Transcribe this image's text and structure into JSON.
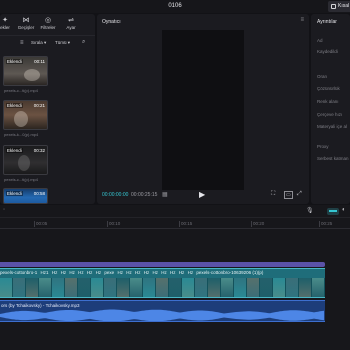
{
  "titlebar": {
    "title": "0106",
    "export_label": "Kısal"
  },
  "media": {
    "tabs": [
      {
        "label": "ekler",
        "icon": "stickers-icon"
      },
      {
        "label": "Geçişler",
        "icon": "transitions-icon"
      },
      {
        "label": "Filtreler",
        "icon": "filters-icon"
      },
      {
        "label": "Ayar",
        "icon": "adjust-icon"
      }
    ],
    "sort_label": "Sırala",
    "all_label": "Tümü",
    "items": [
      {
        "badge": "Eklendi",
        "duration": "00:11",
        "filename": "pexels-c...ti(p).mp4"
      },
      {
        "badge": "Eklendi",
        "duration": "00:21",
        "filename": "pexels-k...0(p).mp4"
      },
      {
        "badge": "Eklendi",
        "duration": "00:32",
        "filename": "pexels-c...ti(p).mp4"
      },
      {
        "badge": "Eklendi",
        "duration": "00:58",
        "filename": ""
      }
    ]
  },
  "player": {
    "title": "Oynatıcı",
    "current_time": "00:00:00:00",
    "total_time": "00:00:25:15"
  },
  "properties": {
    "title": "Ayrıntılar",
    "rows": [
      "Ad",
      "Kaydedildi",
      "Oran",
      "Çözünürlük",
      "Renk alanı",
      "Çerçeve hızı",
      "Materyali içe al",
      "Proxy",
      "Serbest katman"
    ]
  },
  "timeline": {
    "ticks": [
      "00:05",
      "00:10",
      "00:15",
      "00:20",
      "00:25"
    ],
    "clip_labels": [
      "pexels-cottonbro-1",
      "Hz1",
      "Hz",
      "Hz",
      "Hz",
      "Hz",
      "Hz",
      "Hz",
      "pexe",
      "Hz",
      "Hz",
      "Hz",
      "Hz",
      "Hz",
      "Hz",
      "Hz",
      "Hz",
      "Hz",
      "pexels-cottonbro-10639206 (1)(p)"
    ],
    "audio_label": "ors (by Tchaikovsky) - Tchaikovsky.mp3"
  },
  "colors": {
    "accent": "#35c6d1",
    "video_track": "#1f6d7a",
    "audio_track": "#1d3d7a",
    "text_track": "#5a52a8"
  }
}
